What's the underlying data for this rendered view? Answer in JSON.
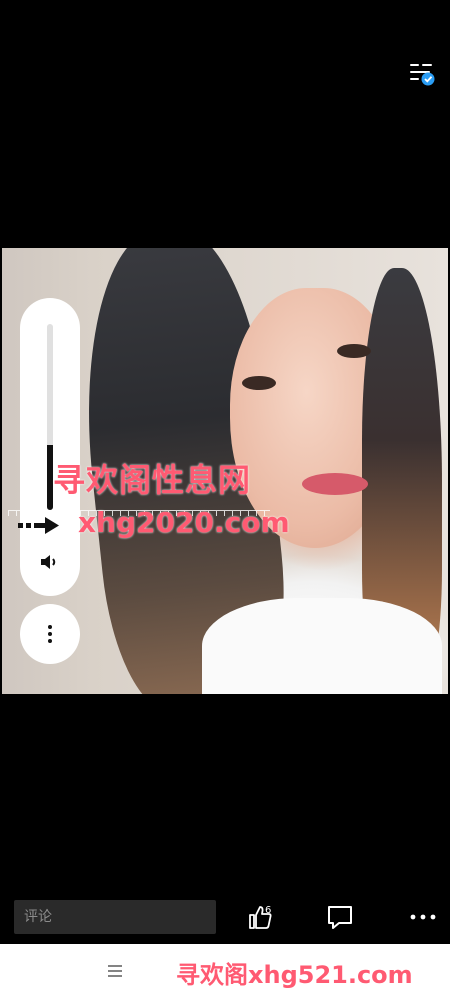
{
  "watermark": {
    "line1": "寻欢阁性息网",
    "line2": "xhg2020.com"
  },
  "volume": {
    "level": 0.35
  },
  "comment": {
    "placeholder": "评论"
  },
  "actions": {
    "like_count": "6"
  },
  "bottom_bar": {
    "logo_text": "寻欢阁xhg521.com"
  },
  "colors": {
    "background": "#000000",
    "watermark": "#ff5a72",
    "verified_badge": "#2a9df4"
  },
  "icons": [
    "settings-sliders-icon",
    "verified-badge-icon",
    "arrow-right-icon",
    "speaker-icon",
    "more-vertical-icon",
    "thumbs-up-icon",
    "comment-icon",
    "more-horizontal-icon",
    "menu-icon"
  ]
}
